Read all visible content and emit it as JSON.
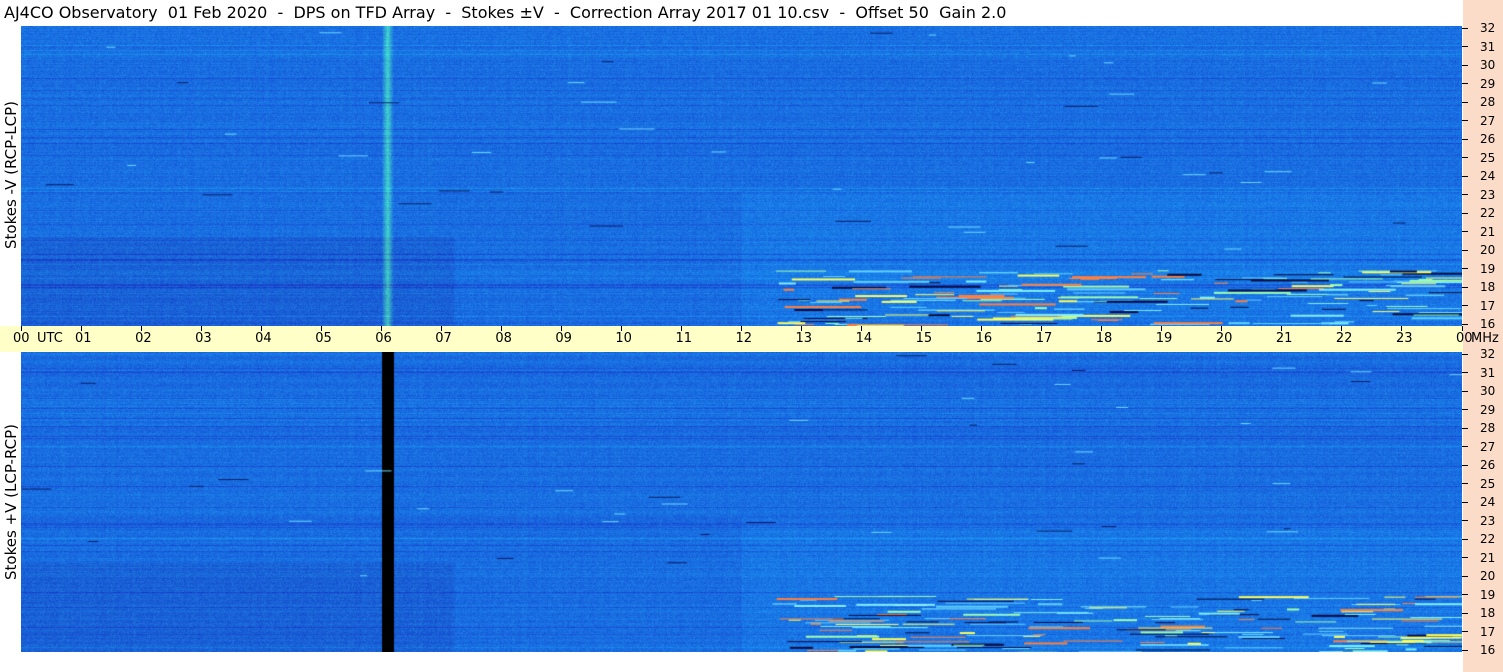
{
  "title": "AJ4CO Observatory  01 Feb 2020  -  DPS on TFD Array  -  Stokes ±V  -  Correction Array 2017 01 10.csv  -  Offset 50  Gain 2.0",
  "colors": {
    "background_blue": "#1f6fe0",
    "axis_band": "#ffffc8",
    "right_strip": "#fbdcc8"
  },
  "chart_data": {
    "type": "heatmap",
    "panels": [
      {
        "name": "Stokes -V (RCP-LCP)",
        "ylabel": "Stokes -V (RCP-LCP)",
        "ylim": [
          16,
          32
        ],
        "y_unit": "MHz",
        "y_ticks": [
          "32",
          "31",
          "30",
          "29",
          "28",
          "27",
          "26",
          "25",
          "24",
          "23",
          "22",
          "21",
          "20",
          "19",
          "18",
          "17",
          "16"
        ],
        "features": [
          {
            "kind": "vertical_band",
            "time_utc": 6.1,
            "color": "cyan"
          },
          {
            "kind": "bursts",
            "time_range": [
              12.5,
              23.5
            ],
            "freq_range": [
              16,
              19
            ]
          }
        ]
      },
      {
        "name": "Stokes +V (LCP-RCP)",
        "ylabel": "Stokes +V (LCP-RCP)",
        "ylim": [
          16,
          32
        ],
        "y_unit": "MHz",
        "y_ticks": [
          "32",
          "31",
          "30",
          "29",
          "28",
          "27",
          "26",
          "25",
          "24",
          "23",
          "22",
          "21",
          "20",
          "19",
          "18",
          "17",
          "16"
        ],
        "features": [
          {
            "kind": "vertical_band",
            "time_utc": 6.1,
            "color": "black"
          },
          {
            "kind": "bursts",
            "time_range": [
              12.5,
              23.5
            ],
            "freq_range": [
              16,
              19
            ]
          }
        ]
      }
    ],
    "x_ticks": [
      "00",
      "01",
      "02",
      "03",
      "04",
      "05",
      "06",
      "07",
      "08",
      "09",
      "10",
      "11",
      "12",
      "13",
      "14",
      "15",
      "16",
      "17",
      "18",
      "19",
      "20",
      "21",
      "22",
      "23",
      "00"
    ],
    "x_unit_label": "UTC",
    "y_unit_label": "MHz",
    "xlim": [
      0,
      24
    ]
  }
}
